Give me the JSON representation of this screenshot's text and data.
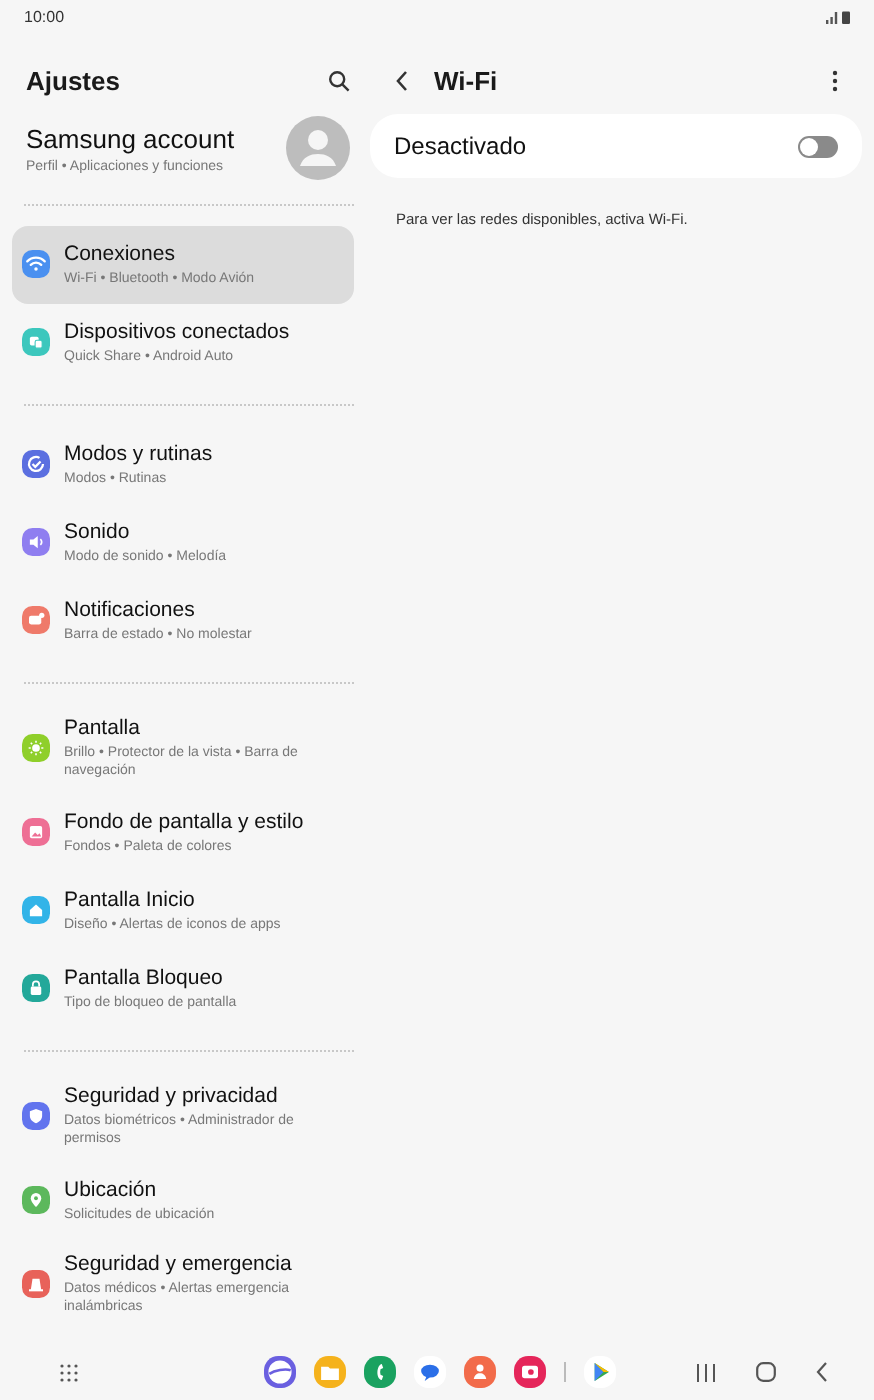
{
  "status_bar": {
    "time": "10:00"
  },
  "sidebar": {
    "title": "Ajustes",
    "account": {
      "name": "Samsung account",
      "subtitle": "Perfil • Aplicaciones y funciones"
    },
    "groups": [
      {
        "items": [
          {
            "kind": "wifi",
            "title": "Conexiones",
            "subtitle": "Wi-Fi • Bluetooth • Modo Avión",
            "color": "#4a90f0",
            "selected": true
          },
          {
            "kind": "devices",
            "title": "Dispositivos conectados",
            "subtitle": "Quick Share • Android Auto",
            "color": "#3cc7bd",
            "selected": false
          }
        ]
      },
      {
        "items": [
          {
            "kind": "check",
            "title": "Modos y rutinas",
            "subtitle": "Modos • Rutinas",
            "color": "#5b6fe0",
            "selected": false
          },
          {
            "kind": "sound",
            "title": "Sonido",
            "subtitle": "Modo de sonido • Melodía",
            "color": "#8f7ef0",
            "selected": false
          },
          {
            "kind": "bell",
            "title": "Notificaciones",
            "subtitle": "Barra de estado • No molestar",
            "color": "#ef7a6a",
            "selected": false
          }
        ]
      },
      {
        "items": [
          {
            "kind": "sun",
            "title": "Pantalla",
            "subtitle": "Brillo • Protector de la vista • Barra de navegación",
            "color": "#8fcf2a",
            "selected": false
          },
          {
            "kind": "image",
            "title": "Fondo de pantalla y estilo",
            "subtitle": "Fondos • Paleta de colores",
            "color": "#ee6f95",
            "selected": false
          },
          {
            "kind": "home",
            "title": "Pantalla Inicio",
            "subtitle": "Diseño • Alertas de iconos de apps",
            "color": "#32b4e8",
            "selected": false
          },
          {
            "kind": "lock",
            "title": "Pantalla Bloqueo",
            "subtitle": "Tipo de bloqueo de pantalla",
            "color": "#23a89a",
            "selected": false
          }
        ]
      },
      {
        "items": [
          {
            "kind": "shield",
            "title": "Seguridad y privacidad",
            "subtitle": "Datos biométricos • Administrador de permisos",
            "color": "#6274ee",
            "selected": false
          },
          {
            "kind": "pin",
            "title": "Ubicación",
            "subtitle": "Solicitudes de ubicación",
            "color": "#5cb85c",
            "selected": false
          },
          {
            "kind": "alert",
            "title": "Seguridad y emergencia",
            "subtitle": "Datos médicos • Alertas emergencia inalámbricas",
            "color": "#e8625a",
            "selected": false
          }
        ]
      }
    ]
  },
  "detail": {
    "title": "Wi-Fi",
    "toggle": {
      "label": "Desactivado",
      "on": false
    },
    "hint": "Para ver las redes disponibles, activa Wi-Fi."
  },
  "taskbar": {
    "apps": [
      {
        "kind": "internet"
      },
      {
        "kind": "files"
      },
      {
        "kind": "phone"
      },
      {
        "kind": "messages"
      },
      {
        "kind": "contacts"
      },
      {
        "kind": "camera"
      },
      {
        "kind": "store"
      }
    ]
  }
}
